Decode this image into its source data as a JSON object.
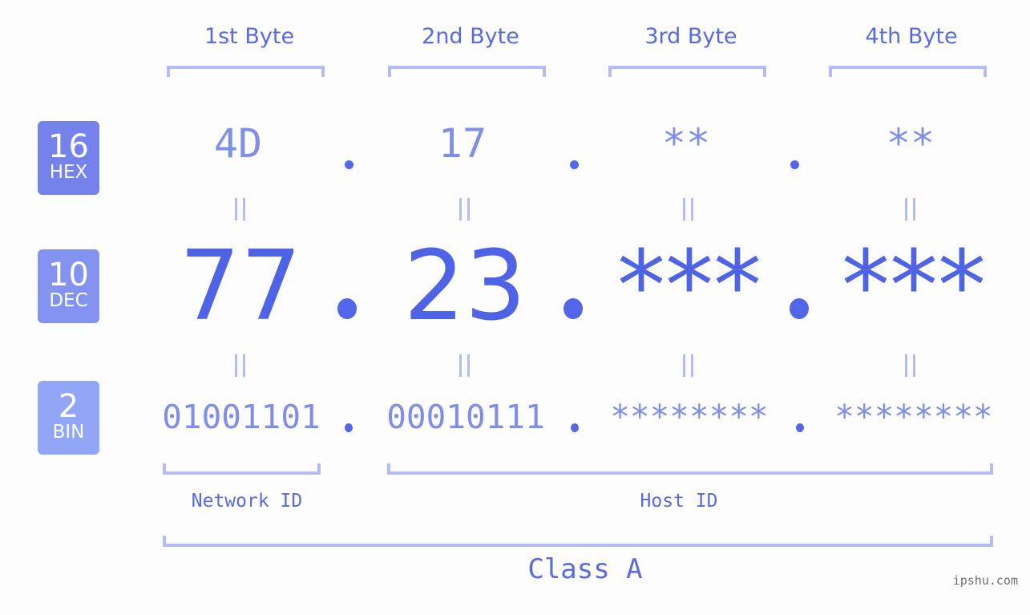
{
  "headers": [
    "1st Byte",
    "2nd Byte",
    "3rd Byte",
    "4th Byte"
  ],
  "badges": {
    "hex": {
      "num": "16",
      "label": "HEX",
      "color": "#7582eb"
    },
    "dec": {
      "num": "10",
      "label": "DEC",
      "color": "#8493f0"
    },
    "bin": {
      "num": "2",
      "label": "BIN",
      "color": "#91a6f7"
    }
  },
  "hex": [
    "4D",
    "17",
    "**",
    "**"
  ],
  "dec": [
    "77",
    "23",
    "***",
    "***"
  ],
  "bin": [
    "01001101",
    "00010111",
    "********",
    "********"
  ],
  "network_label": "Network ID",
  "host_label": "Host ID",
  "class_label": "Class A",
  "watermark": "ipshu.com",
  "colors": {
    "accent": "#4f63e6",
    "light": "#7f8ee9",
    "bracket": "#b3bcf7"
  }
}
